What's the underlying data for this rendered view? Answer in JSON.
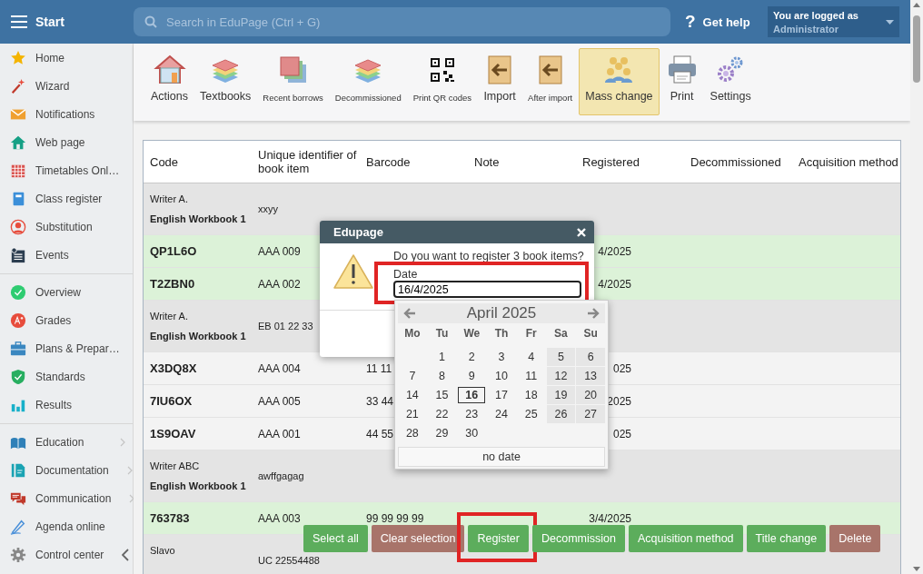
{
  "header": {
    "title": "Start",
    "search": {
      "placeholder": "Search in EduPage (Ctrl + G)"
    },
    "help": {
      "icon": "?",
      "label": "Get help"
    },
    "login": {
      "caption": "You are logged as",
      "user": "Administrator"
    }
  },
  "sidebar": {
    "groups": [
      [
        {
          "label": "Home"
        },
        {
          "label": "Wizard"
        },
        {
          "label": "Notifications"
        },
        {
          "label": "Web page"
        },
        {
          "label": "Timetables Onl…"
        },
        {
          "label": "Class register"
        },
        {
          "label": "Substitution"
        },
        {
          "label": "Events"
        }
      ],
      [
        {
          "label": "Overview"
        },
        {
          "label": "Grades"
        },
        {
          "label": "Plans & Prepar…"
        },
        {
          "label": "Standards"
        },
        {
          "label": "Results"
        }
      ],
      [
        {
          "label": "Education",
          "submenu": true
        },
        {
          "label": "Documentation",
          "submenu": true
        },
        {
          "label": "Communication",
          "submenu": true
        },
        {
          "label": "Agenda online"
        },
        {
          "label": "Control center",
          "collapsible": true
        }
      ]
    ]
  },
  "toolbar": {
    "items": [
      {
        "label": "Actions",
        "compact": false,
        "selected": false
      },
      {
        "label": "Textbooks",
        "compact": false,
        "selected": false
      },
      {
        "label": "Recent borrows",
        "compact": true,
        "selected": false
      },
      {
        "label": "Decommissioned",
        "compact": true,
        "selected": false
      },
      {
        "label": "Print QR codes",
        "compact": true,
        "selected": false
      },
      {
        "label": "Import",
        "compact": false,
        "selected": false
      },
      {
        "label": "After import",
        "compact": true,
        "selected": false
      },
      {
        "label": "Mass change",
        "compact": false,
        "selected": true
      },
      {
        "label": "Print",
        "compact": false,
        "selected": false
      },
      {
        "label": "Settings",
        "compact": false,
        "selected": false
      }
    ]
  },
  "table": {
    "columns": [
      "Code",
      "Unique identifier of book item",
      "Barcode",
      "Note",
      "Registered",
      "Decommissioned",
      "Acquisition method"
    ],
    "rows": [
      {
        "kind": "group",
        "author": "Writer A.",
        "title": "English Workbook 1",
        "identifier": "xxyy"
      },
      {
        "kind": "item",
        "selected": true,
        "code": "QP1L6O",
        "identifier": "AAA 009",
        "registered": "4/2025"
      },
      {
        "kind": "item",
        "selected": true,
        "code": "T2ZBN0",
        "identifier": "AAA 002",
        "registered": "4/2025"
      },
      {
        "kind": "group",
        "author": "Writer A.",
        "title": "English Workbook 1",
        "identifier": "EB 01 22 33"
      },
      {
        "kind": "item",
        "selected": false,
        "code": "X3DQ8X",
        "identifier": "AAA 004",
        "barcode": "11 11",
        "registered": "025"
      },
      {
        "kind": "item",
        "selected": false,
        "code": "7IU6OX",
        "identifier": "AAA 005",
        "barcode": "33 44",
        "registered": "2025"
      },
      {
        "kind": "item",
        "selected": false,
        "code": "1S9OAV",
        "identifier": "AAA 001",
        "barcode": "44 55",
        "registered": "025"
      },
      {
        "kind": "group",
        "author": "Writer ABC",
        "title": "English Workbook 1",
        "identifier": "awffgagag"
      },
      {
        "kind": "item",
        "selected": true,
        "code": "763783",
        "identifier": "AAA 003",
        "barcode": "99 99 99 99",
        "registered": "3/4/2025"
      },
      {
        "kind": "group",
        "author": "Slavo",
        "identifier": "UC 22554488"
      }
    ]
  },
  "dialog": {
    "title": "Edupage",
    "message": "Do you want to register 3 book items?",
    "date_label": "Date",
    "date_value": "16/4/2025",
    "highlighted": true
  },
  "date_picker": {
    "month": "April 2025",
    "weekdays": [
      "Mo",
      "Tu",
      "We",
      "Th",
      "Fr",
      "Sa",
      "Su"
    ],
    "weeks": [
      {
        "kind": "first",
        "days": [
          {
            "day": "1",
            "selected": false
          },
          {
            "day": "2",
            "selected": false
          },
          {
            "day": "3",
            "selected": false
          },
          {
            "day": "4",
            "selected": false
          },
          {
            "day": "5",
            "selected": false
          },
          {
            "day": "6",
            "selected": false
          }
        ]
      },
      {
        "kind": "full",
        "days": [
          {
            "day": "7",
            "selected": false
          },
          {
            "day": "8",
            "selected": false
          },
          {
            "day": "9",
            "selected": false
          },
          {
            "day": "10",
            "selected": false
          },
          {
            "day": "11",
            "selected": false
          },
          {
            "day": "12",
            "selected": false
          },
          {
            "day": "13",
            "selected": false
          }
        ]
      },
      {
        "kind": "full",
        "days": [
          {
            "day": "14",
            "selected": false
          },
          {
            "day": "15",
            "selected": false
          },
          {
            "day": "16",
            "selected": true
          },
          {
            "day": "17",
            "selected": false
          },
          {
            "day": "18",
            "selected": false
          },
          {
            "day": "19",
            "selected": false
          },
          {
            "day": "20",
            "selected": false
          }
        ]
      },
      {
        "kind": "full",
        "days": [
          {
            "day": "21",
            "selected": false
          },
          {
            "day": "22",
            "selected": false
          },
          {
            "day": "23",
            "selected": false
          },
          {
            "day": "24",
            "selected": false
          },
          {
            "day": "25",
            "selected": false
          },
          {
            "day": "26",
            "selected": false
          },
          {
            "day": "27",
            "selected": false
          }
        ]
      },
      {
        "kind": "last",
        "days": [
          {
            "day": "28",
            "selected": false
          },
          {
            "day": "29",
            "selected": false
          },
          {
            "day": "30",
            "selected": false
          }
        ]
      }
    ],
    "clear": "no date"
  },
  "actions": [
    {
      "label": "Select all",
      "kind": "confirm",
      "highlighted": false
    },
    {
      "label": "Clear selection",
      "kind": "cancel",
      "highlighted": false
    },
    {
      "label": "Register",
      "kind": "confirm",
      "highlighted": true
    },
    {
      "label": "Decommission",
      "kind": "confirm",
      "highlighted": false
    },
    {
      "label": "Acquisition method",
      "kind": "confirm",
      "highlighted": false
    },
    {
      "label": "Title change",
      "kind": "confirm",
      "highlighted": false
    },
    {
      "label": "Delete",
      "kind": "cancel",
      "highlighted": false
    }
  ]
}
